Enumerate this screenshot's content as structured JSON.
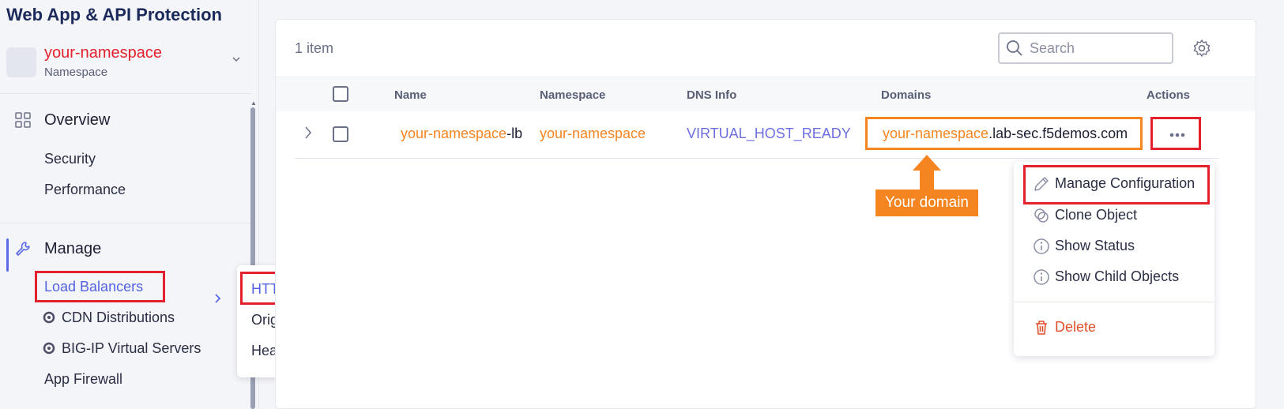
{
  "app": {
    "title": "Web App & API Protection"
  },
  "namespace": {
    "name": "your-namespace",
    "label": "Namespace"
  },
  "sidebar": {
    "overview": "Overview",
    "overview_items": [
      "Security",
      "Performance"
    ],
    "manage": "Manage",
    "manage_items": [
      "Load Balancers",
      "CDN Distributions",
      "BIG-IP Virtual Servers",
      "App Firewall"
    ]
  },
  "flyout": {
    "items": [
      "HTTP Load Balancers",
      "Origin Pools",
      "Health Checks"
    ]
  },
  "table": {
    "count": "1 item",
    "search_placeholder": "Search",
    "headers": [
      "Name",
      "Namespace",
      "DNS Info",
      "Domains",
      "Actions"
    ],
    "row": {
      "name_prefix": "your-namespace",
      "name_suffix": "-lb",
      "namespace": "your-namespace",
      "dns": "VIRTUAL_HOST_READY",
      "domain_prefix": "your-namespace",
      "domain_suffix": ".lab-sec.f5demos.com"
    }
  },
  "annotation": {
    "callout": "Your domain"
  },
  "actions_menu": {
    "items": [
      "Manage Configuration",
      "Clone Object",
      "Show Status",
      "Show Child Objects"
    ],
    "delete": "Delete"
  },
  "colors": {
    "highlight_red": "#e3212d",
    "highlight_orange": "#f58520",
    "link_blue": "#5262e0"
  }
}
